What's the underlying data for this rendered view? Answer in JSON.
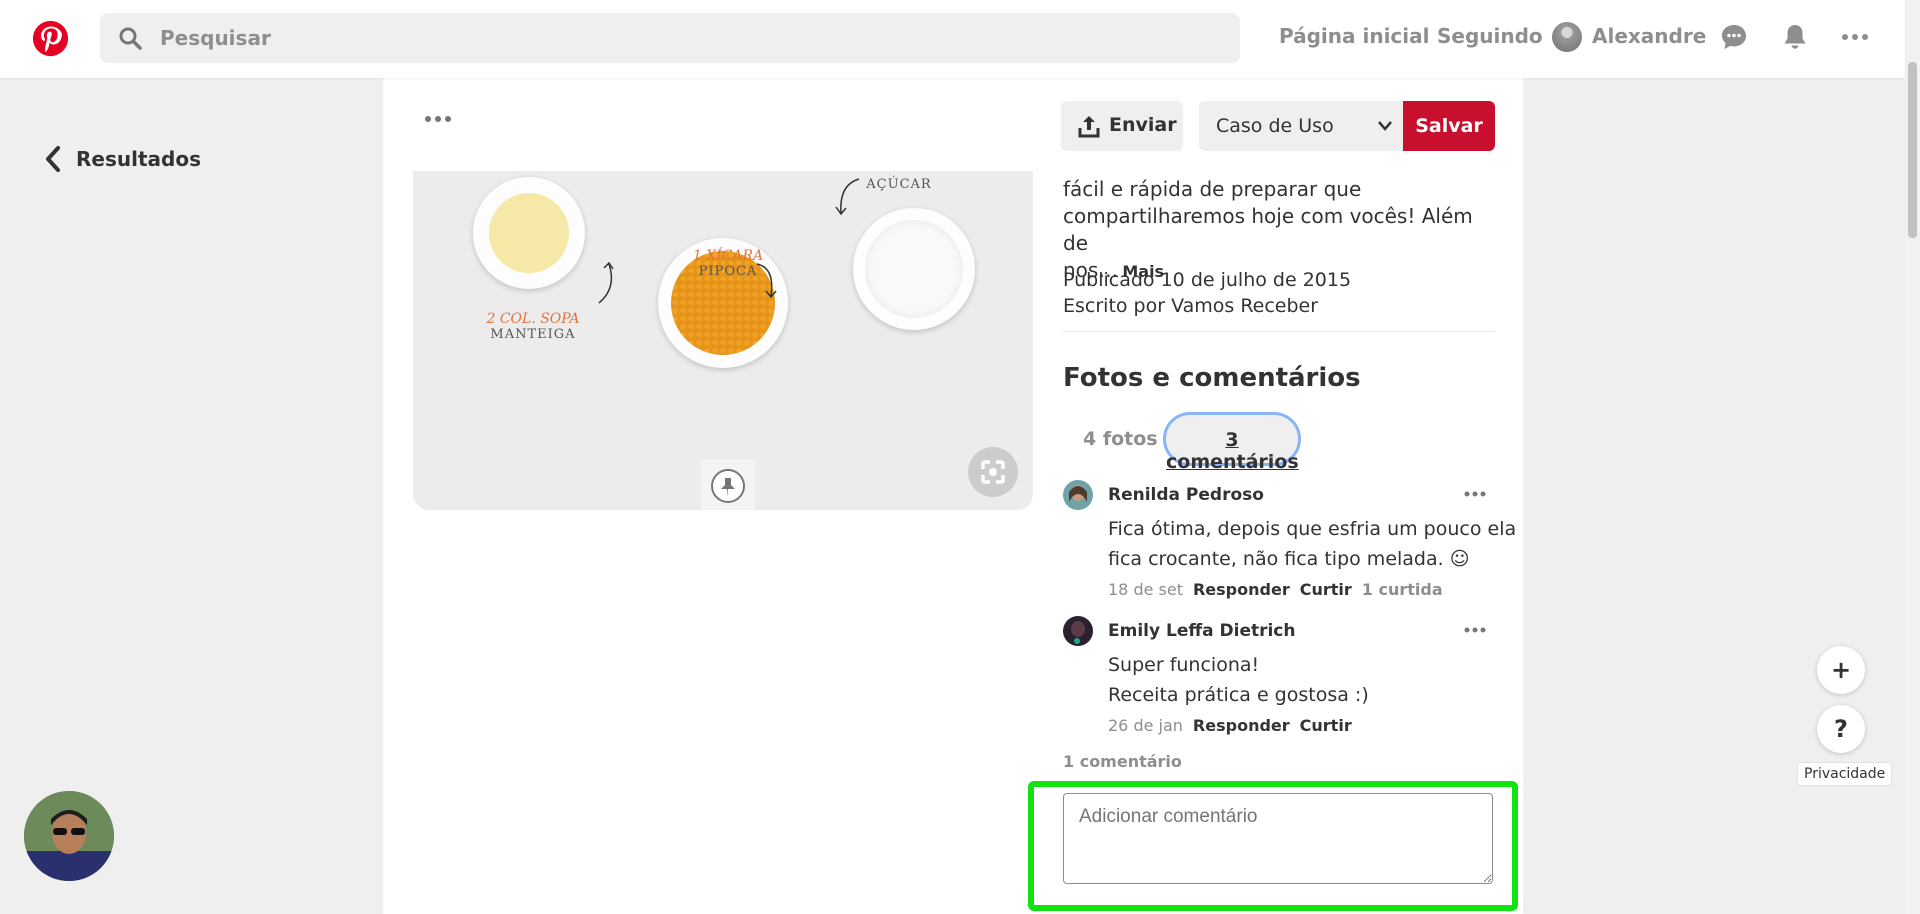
{
  "header": {
    "search_placeholder": "Pesquisar",
    "nav_home": "Página inicial",
    "nav_following": "Seguindo",
    "user_name": "Alexandre",
    "brand_color": "#e60023"
  },
  "left": {
    "back_label": "Resultados"
  },
  "pin": {
    "image_labels": [
      {
        "qty": "",
        "name": "AÇÚCAR"
      },
      {
        "qty": "1 XÍCARA",
        "name": "PIPOCA"
      },
      {
        "qty": "2 COL. SOPA",
        "name": "MANTEIGA"
      }
    ],
    "send_label": "Enviar",
    "board_value": "Caso de Uso",
    "save_label": "Salvar",
    "description_lines": [
      "fácil e rápida de preparar que",
      "compartilharemos hoje com vocês! Além de",
      "nos…"
    ],
    "more_label": "Mais",
    "published": "Publicado 10 de julho de 2015",
    "author": "Escrito por Vamos Receber"
  },
  "comments_section": {
    "title": "Fotos e comentários",
    "tab_photos": "4 fotos",
    "tab_comments": "3 comentários",
    "comments": [
      {
        "author": "Renilda Pedroso",
        "text_lines": [
          "Fica ótima, depois que esfria um pouco ela",
          "fica crocante, não fica tipo melada. ☺"
        ],
        "date": "18 de set",
        "reply": "Responder",
        "like": "Curtir",
        "likes": "1 curtida"
      },
      {
        "author": "Emily Leffa Dietrich",
        "text_lines": [
          "Super funciona!",
          "Receita prática e gostosa :)"
        ],
        "date": "26 de jan",
        "reply": "Responder",
        "like": "Curtir"
      }
    ],
    "more_count": "1 comentário",
    "input_placeholder": "Adicionar comentário"
  },
  "floating": {
    "add": "+",
    "help": "?",
    "privacy": "Privacidade"
  }
}
